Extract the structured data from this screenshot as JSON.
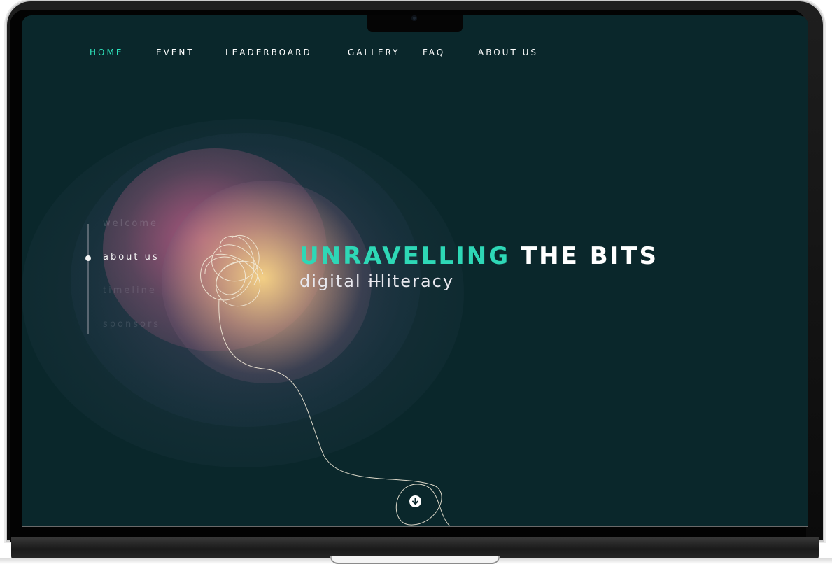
{
  "nav": {
    "items": [
      {
        "label": "HOME",
        "active": true
      },
      {
        "label": "EVENT",
        "active": false
      },
      {
        "label": "LEADERBOARD",
        "active": false
      },
      {
        "label": "GALLERY",
        "active": false
      },
      {
        "label": "FAQ",
        "active": false
      },
      {
        "label": "ABOUT US",
        "active": false
      }
    ]
  },
  "sections": {
    "items": [
      {
        "label": "welcome"
      },
      {
        "label": "about us"
      },
      {
        "label": "timeline"
      },
      {
        "label": "sponsors"
      }
    ],
    "current": "about us"
  },
  "hero": {
    "title_accent": "UNRAVELLING",
    "title_rest": "THE BITS",
    "subtitle_prefix": "digital ",
    "subtitle_struck": "il",
    "subtitle_suffix": "literacy"
  },
  "scroll_button": {
    "icon": "arrow-down-circle-icon"
  },
  "colors": {
    "background": "#0a272b",
    "accent": "#2ed7b6",
    "nav_active": "#2ee8bf",
    "text": "#ffffff"
  }
}
